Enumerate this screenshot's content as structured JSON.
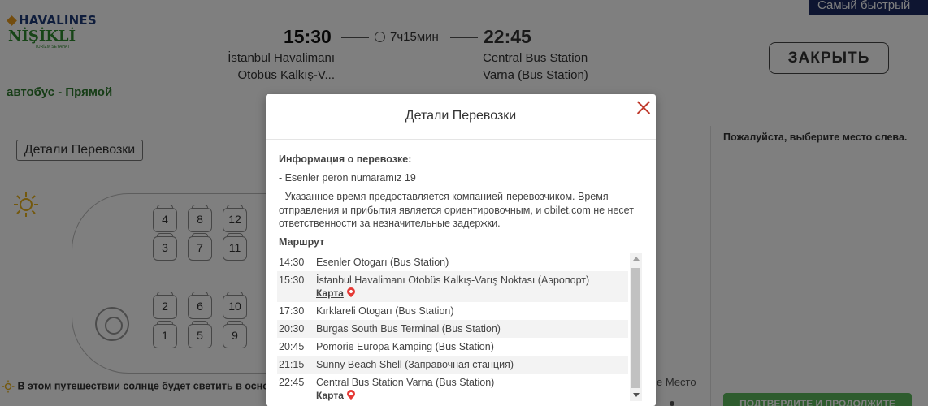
{
  "header": {
    "brand_top": "HAVALINES",
    "brand_bottom": "NİŞİKLİ",
    "brand_tag": "TURİZM SEYAHAT",
    "bus_type": "автобус - Прямой",
    "departure_time": "15:30",
    "duration": "7ч15мин",
    "arrival_time": "22:45",
    "departure_station": "İstanbul Havalimanı Otobüs Kalkış-V...",
    "arrival_station": "Central Bus Station Varna (Bus Station)",
    "fastest_badge": "Самый быстрый",
    "close_button": "ЗАКРЫТЬ"
  },
  "page": {
    "details_button": "Детали Перевозки",
    "sun_note": "В этом путешествии солнце будет светить в основном",
    "right_prompt": "Пожалуйста, выберите место слева.",
    "legend_label": "е Место",
    "confirm_button": "ПОДТВЕРДИТЕ И ПРОДОЛЖИТЕ",
    "seats": [
      "4",
      "8",
      "12",
      "3",
      "7",
      "11",
      "2",
      "6",
      "10",
      "1",
      "5",
      "9"
    ]
  },
  "modal": {
    "title": "Детали Перевозки",
    "info_heading": "Информация о перевозке:",
    "info_line1": "- Esenler peron numaramız 19",
    "info_line2": "- Указанное время предоставляется компанией-перевозчиком. Время отправления и прибытия является ориентировочным, и obilet.com не несет ответственности за незначительные задержки.",
    "route_heading": "Маршрут",
    "map_label": "Карта",
    "route": [
      {
        "time": "14:30",
        "place": "Esenler Otogarı (Bus Station)"
      },
      {
        "time": "15:30",
        "place": "İstanbul Havalimanı Otobüs Kalkış-Varış Noktası (Аэропорт)"
      },
      {
        "time": "17:30",
        "place": "Kırklareli Otogarı (Bus Station)"
      },
      {
        "time": "20:30",
        "place": "Burgas South Bus Terminal (Bus Station)"
      },
      {
        "time": "20:45",
        "place": "Pomorie Europa Kamping (Bus Station)"
      },
      {
        "time": "21:15",
        "place": "Sunny Beach Shell (Заправочная станция)"
      },
      {
        "time": "22:45",
        "place": "Central Bus Station Varna (Bus Station)"
      }
    ]
  },
  "colors": {
    "brand_blue": "#1f3a78",
    "brand_green": "#2f8a2f",
    "badge_navy": "#1c2b63",
    "close_red": "#c0392b",
    "pin_red": "#e53935",
    "confirm_green": "#5cb85c"
  },
  "icons": [
    "clock-icon",
    "sun-icon",
    "steering-wheel-icon",
    "close-icon",
    "map-pin-icon"
  ]
}
